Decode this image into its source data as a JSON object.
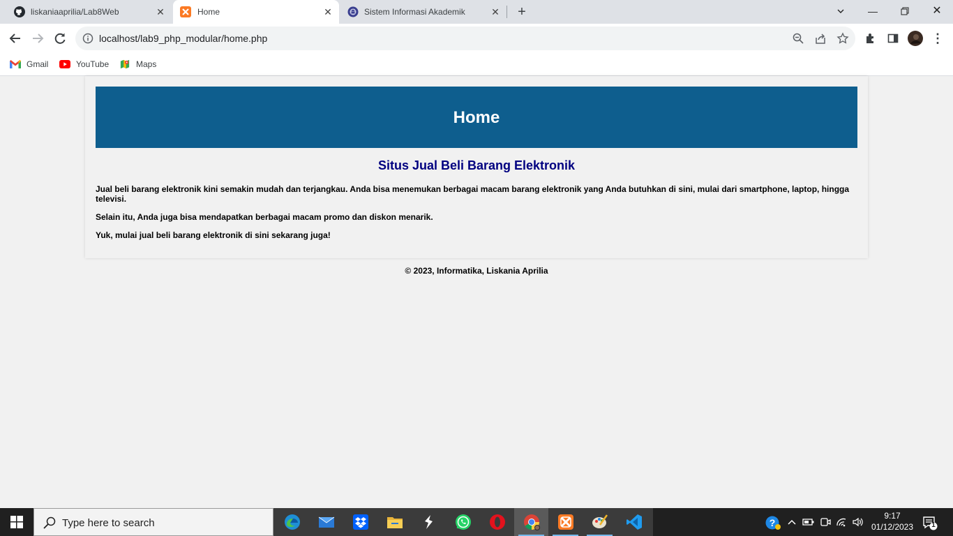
{
  "browser": {
    "tabs": [
      {
        "title": "liskaniaaprilia/Lab8Web",
        "icon": "github-icon",
        "active": false
      },
      {
        "title": "Home",
        "icon": "xampp-icon",
        "active": true
      },
      {
        "title": "Sistem Informasi Akademik",
        "icon": "university-icon",
        "active": false
      }
    ],
    "url": "localhost/lab9_php_modular/home.php",
    "bookmarks": [
      {
        "label": "Gmail",
        "icon": "gmail-icon"
      },
      {
        "label": "YouTube",
        "icon": "youtube-icon"
      },
      {
        "label": "Maps",
        "icon": "maps-icon"
      }
    ]
  },
  "page": {
    "header_title": "Home",
    "content_title": "Situs Jual Beli Barang Elektronik",
    "paragraphs": [
      "Jual beli barang elektronik kini semakin mudah dan terjangkau. Anda bisa menemukan berbagai macam barang elektronik yang Anda butuhkan di sini, mulai dari smartphone, laptop, hingga televisi.",
      "Selain itu, Anda juga bisa mendapatkan berbagai macam promo dan diskon menarik.",
      "Yuk, mulai jual beli barang elektronik di sini sekarang juga!"
    ],
    "footer": "© 2023, Informatika, Liskania Aprilia",
    "colors": {
      "header_bg": "#0e5e8e",
      "title_color": "#000080"
    }
  },
  "taskbar": {
    "search_placeholder": "Type here to search",
    "apps": [
      "edge-icon",
      "mail-icon",
      "dropbox-icon",
      "file-explorer-icon",
      "sublime-icon",
      "whatsapp-icon",
      "opera-icon",
      "chrome-icon",
      "xampp-icon",
      "paint-icon",
      "vscode-icon"
    ],
    "time": "9:17",
    "date": "01/12/2023",
    "notification_count": "1"
  }
}
